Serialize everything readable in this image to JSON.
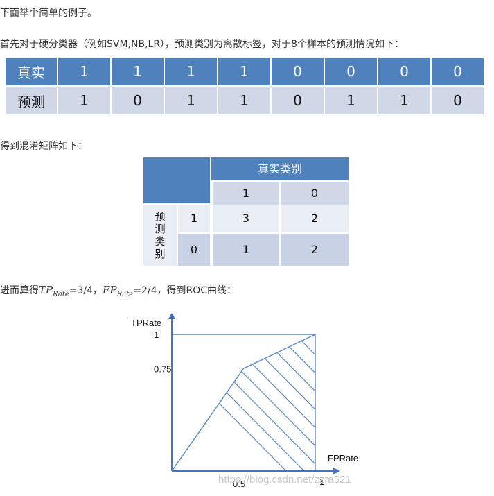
{
  "text": {
    "intro": "下面举个简单的例子。",
    "classifier": "首先对于硬分类器（例如SVM,NB,LR），预测类别为离散标签，对于8个样本的预测情况如下：",
    "cm_intro": "得到混淆矩阵如下：",
    "calc_prefix": "进而算得",
    "tp_main": "TP",
    "tp_sub": "Rate",
    "tp_value": "=3/4，",
    "fp_main": "FP",
    "fp_sub": "Rate",
    "fp_value": "=2/4，得到ROC曲线："
  },
  "prediction_table": {
    "true_label": "真实",
    "pred_label": "预测",
    "true_values": [
      "1",
      "1",
      "1",
      "1",
      "0",
      "0",
      "0",
      "0"
    ],
    "pred_values": [
      "1",
      "0",
      "1",
      "1",
      "0",
      "1",
      "1",
      "0"
    ]
  },
  "confusion_matrix": {
    "col_header": "真实类别",
    "col_labels": [
      "1",
      "0"
    ],
    "row_header": "预测类别",
    "row_labels": [
      "1",
      "0"
    ],
    "cells": [
      [
        "3",
        "2"
      ],
      [
        "1",
        "2"
      ]
    ]
  },
  "chart_data": {
    "type": "line",
    "x": [
      0,
      0.5,
      1
    ],
    "y": [
      0,
      0.75,
      1
    ],
    "xlabel": "FPRate",
    "ylabel": "TPRate",
    "xticks": [
      "0.5",
      "1"
    ],
    "yticks": [
      "0.75",
      "1"
    ],
    "xlim": [
      0,
      1
    ],
    "ylim": [
      0,
      1
    ],
    "area_under_curve": "hatched",
    "colors": {
      "axis": "#4472c4",
      "curve": "#5b8fc9"
    }
  },
  "watermark": "https://blog.csdn.net/zzra521"
}
